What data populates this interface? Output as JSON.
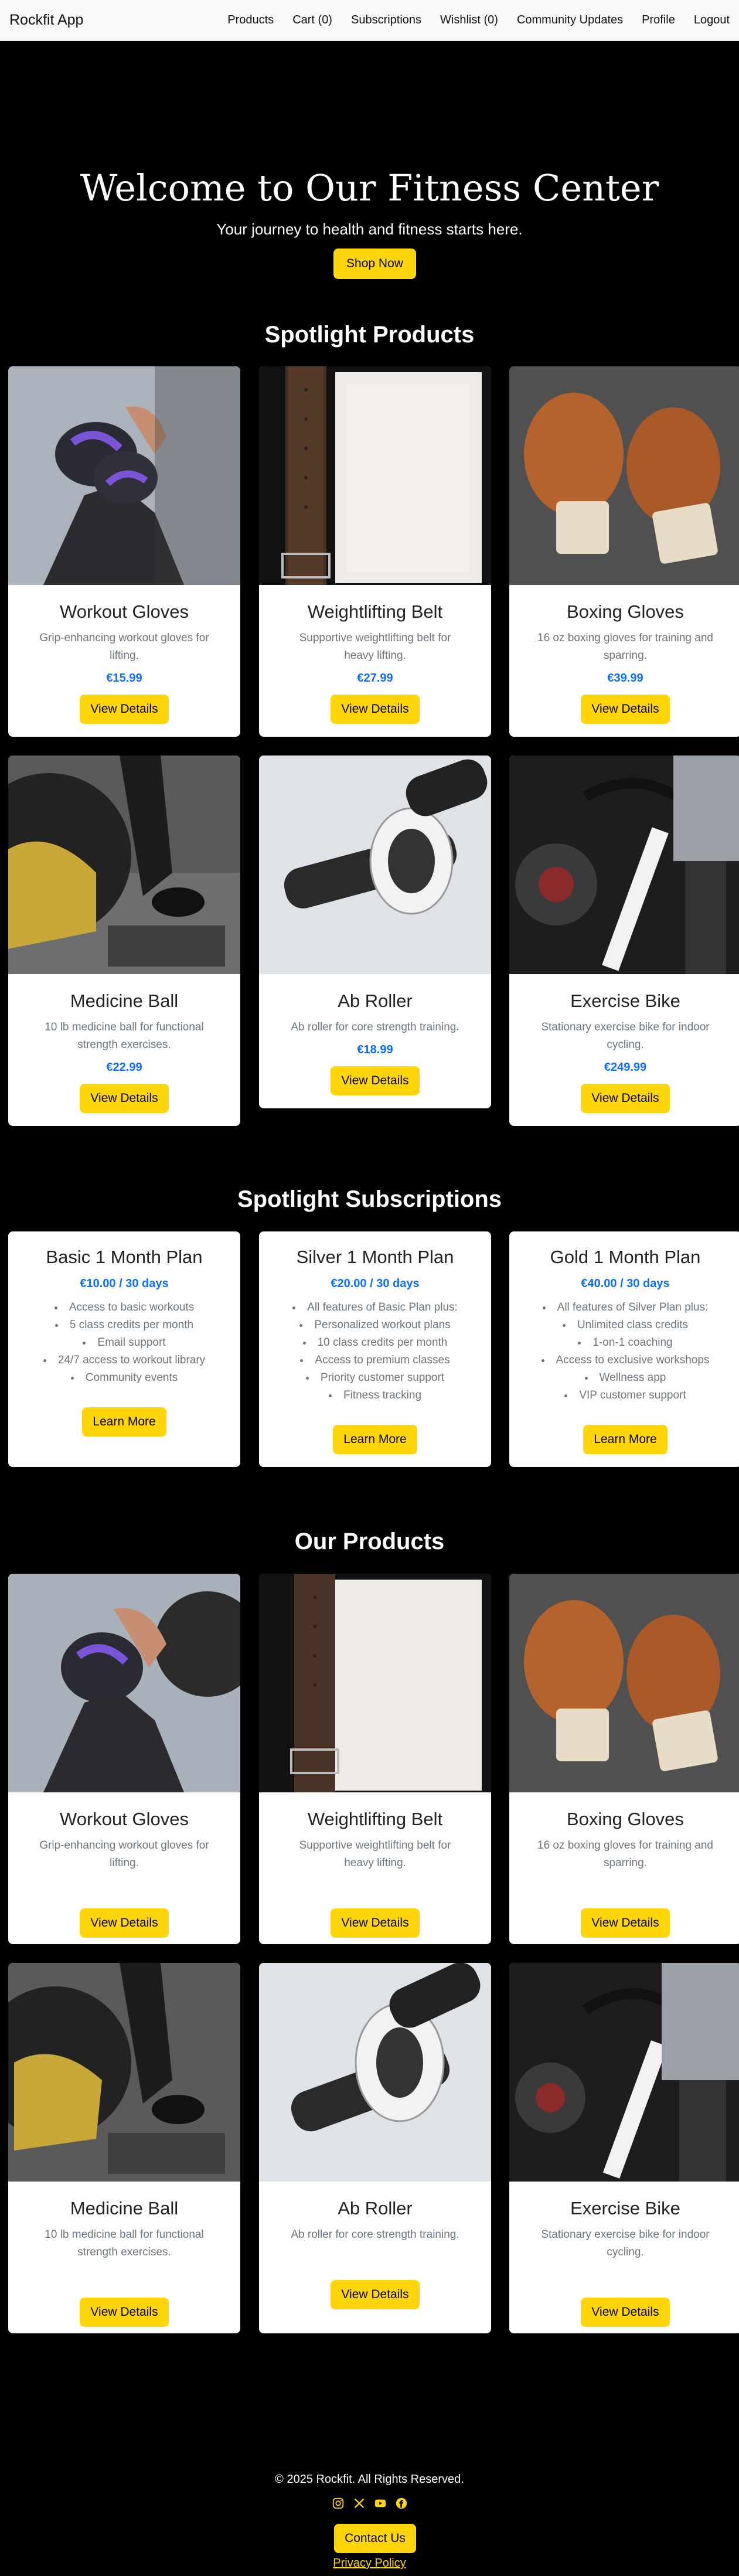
{
  "navbar": {
    "brand": "Rockfit App",
    "links": [
      "Products",
      "Cart (0)",
      "Subscriptions",
      "Wishlist (0)",
      "Community Updates",
      "Profile",
      "Logout"
    ]
  },
  "hero": {
    "title": "Welcome to Our Fitness Center",
    "subtitle": "Your journey to health and fitness starts here.",
    "button": "Shop Now"
  },
  "spotlight_products": {
    "title": "Spotlight Products",
    "items": [
      {
        "name": "Workout Gloves",
        "desc": "Grip-enhancing workout gloves for lifting.",
        "price": "€15.99",
        "button": "View Details",
        "image": "workout-gloves-photo"
      },
      {
        "name": "Weightlifting Belt",
        "desc": "Supportive weightlifting belt for heavy lifting.",
        "price": "€27.99",
        "button": "View Details",
        "image": "weightlifting-belt-photo"
      },
      {
        "name": "Boxing Gloves",
        "desc": "16 oz boxing gloves for training and sparring.",
        "price": "€39.99",
        "button": "View Details",
        "image": "boxing-gloves-photo"
      },
      {
        "name": "Medicine Ball",
        "desc": "10 lb medicine ball for functional strength exercises.",
        "price": "€22.99",
        "button": "View Details",
        "image": "medicine-ball-photo"
      },
      {
        "name": "Ab Roller",
        "desc": "Ab roller for core strength training.",
        "price": "€18.99",
        "button": "View Details",
        "image": "ab-roller-photo"
      },
      {
        "name": "Exercise Bike",
        "desc": "Stationary exercise bike for indoor cycling.",
        "price": "€249.99",
        "button": "View Details",
        "image": "exercise-bike-photo"
      }
    ]
  },
  "spotlight_subscriptions": {
    "title": "Spotlight Subscriptions",
    "plans": [
      {
        "name": "Basic 1 Month Plan",
        "price": "€10.00 / 30 days",
        "features": [
          "Access to basic workouts",
          "5 class credits per month",
          "Email support",
          "24/7 access to workout library",
          "Community events"
        ],
        "button": "Learn More"
      },
      {
        "name": "Silver 1 Month Plan",
        "price": "€20.00 / 30 days",
        "features": [
          "All features of Basic Plan plus:",
          "Personalized workout plans",
          "10 class credits per month",
          "Access to premium classes",
          "Priority customer support",
          "Fitness tracking"
        ],
        "button": "Learn More"
      },
      {
        "name": "Gold 1 Month Plan",
        "price": "€40.00 / 30 days",
        "features": [
          "All features of Silver Plan plus:",
          "Unlimited class credits",
          "1-on-1 coaching",
          "Access to exclusive workshops",
          "Wellness app",
          "VIP customer support"
        ],
        "button": "Learn More"
      }
    ]
  },
  "our_products": {
    "title": "Our Products",
    "items": [
      {
        "name": "Workout Gloves",
        "desc": "Grip-enhancing workout gloves for lifting.",
        "button": "View Details"
      },
      {
        "name": "Weightlifting Belt",
        "desc": "Supportive weightlifting belt for heavy lifting.",
        "button": "View Details"
      },
      {
        "name": "Boxing Gloves",
        "desc": "16 oz boxing gloves for training and sparring.",
        "button": "View Details"
      },
      {
        "name": "Medicine Ball",
        "desc": "10 lb medicine ball for functional strength exercises.",
        "button": "View Details"
      },
      {
        "name": "Ab Roller",
        "desc": "Ab roller for core strength training.",
        "button": "View Details"
      },
      {
        "name": "Exercise Bike",
        "desc": "Stationary exercise bike for indoor cycling.",
        "button": "View Details"
      }
    ]
  },
  "footer": {
    "copyright": "© 2025 Rockfit. All Rights Reserved.",
    "socials": [
      "instagram-icon",
      "x-icon",
      "youtube-icon",
      "facebook-icon"
    ],
    "contact_button": "Contact Us",
    "privacy_link": "Privacy Policy"
  },
  "colors": {
    "accent": "#ffd60a",
    "price": "#0d6efd",
    "background": "#000000",
    "navbar": "#f8f9fa"
  }
}
